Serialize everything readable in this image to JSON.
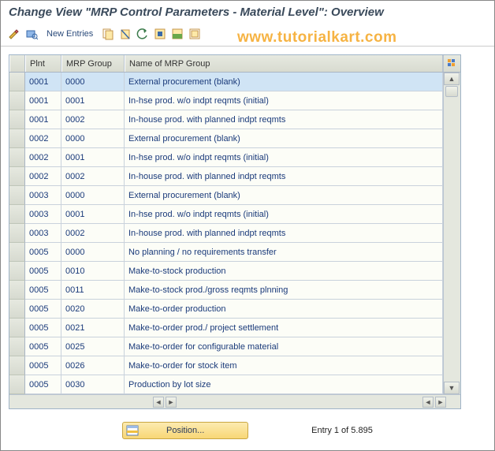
{
  "title": "Change View \"MRP Control Parameters - Material Level\": Overview",
  "toolbar": {
    "new_entries": "New Entries"
  },
  "watermark": "www.tutorialkart.com",
  "table": {
    "headers": {
      "plnt": "Plnt",
      "grp": "MRP Group",
      "name": "Name of MRP Group"
    },
    "rows": [
      {
        "plnt": "0001",
        "grp": "0000",
        "name": "External procurement             (blank)"
      },
      {
        "plnt": "0001",
        "grp": "0001",
        "name": "In-hse prod. w/o indpt reqmts (initial)"
      },
      {
        "plnt": "0001",
        "grp": "0002",
        "name": "In-house prod. with planned indpt reqmts"
      },
      {
        "plnt": "0002",
        "grp": "0000",
        "name": "External procurement             (blank)"
      },
      {
        "plnt": "0002",
        "grp": "0001",
        "name": "In-hse prod. w/o indpt reqmts (initial)"
      },
      {
        "plnt": "0002",
        "grp": "0002",
        "name": "In-house prod. with planned indpt reqmts"
      },
      {
        "plnt": "0003",
        "grp": "0000",
        "name": "External procurement             (blank)"
      },
      {
        "plnt": "0003",
        "grp": "0001",
        "name": "In-hse prod. w/o indpt reqmts (initial)"
      },
      {
        "plnt": "0003",
        "grp": "0002",
        "name": "In-house prod. with planned indpt reqmts"
      },
      {
        "plnt": "0005",
        "grp": "0000",
        "name": "No planning / no requirements transfer"
      },
      {
        "plnt": "0005",
        "grp": "0010",
        "name": "Make-to-stock production"
      },
      {
        "plnt": "0005",
        "grp": "0011",
        "name": "Make-to-stock prod./gross reqmts plnning"
      },
      {
        "plnt": "0005",
        "grp": "0020",
        "name": "Make-to-order production"
      },
      {
        "plnt": "0005",
        "grp": "0021",
        "name": "Make-to-order prod./ project settlement"
      },
      {
        "plnt": "0005",
        "grp": "0025",
        "name": "Make-to-order for configurable material"
      },
      {
        "plnt": "0005",
        "grp": "0026",
        "name": "Make-to-order for stock item"
      },
      {
        "plnt": "0005",
        "grp": "0030",
        "name": "Production by lot size"
      }
    ]
  },
  "footer": {
    "position_label": "Position...",
    "entry_text": "Entry 1 of 5.895"
  }
}
